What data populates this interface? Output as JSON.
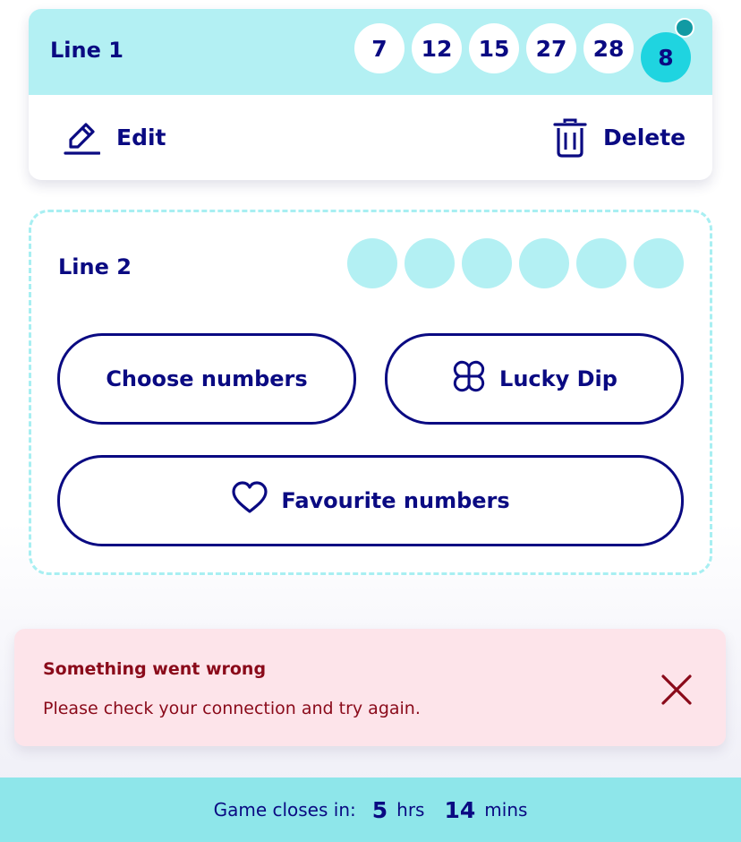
{
  "line1": {
    "title": "Line 1",
    "numbers": [
      "7",
      "12",
      "15",
      "27",
      "28"
    ],
    "bonus": "8",
    "edit_label": "Edit",
    "delete_label": "Delete"
  },
  "line2": {
    "title": "Line 2",
    "choose_label": "Choose numbers",
    "lucky_dip_label": "Lucky Dip",
    "favourite_label": "Favourite numbers"
  },
  "error": {
    "title": "Something went wrong",
    "message": "Please check your connection and try again."
  },
  "footer": {
    "label": "Game closes in:",
    "hours": "5",
    "hours_unit": "hrs",
    "minutes": "14",
    "minutes_unit": "mins"
  },
  "colors": {
    "brand_navy": "#0a0a82",
    "line_header": "#b3f0f3",
    "bonus_ball": "#1fd4e0",
    "error_bg": "#fde4ea",
    "error_text": "#8a0a1a",
    "footer_bg": "#8ee6ea"
  }
}
